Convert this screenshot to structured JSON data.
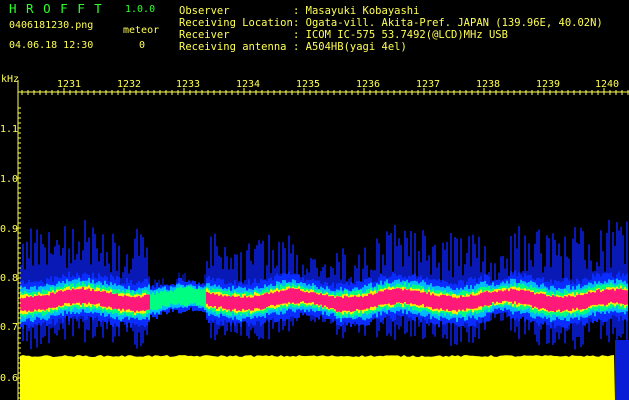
{
  "header": {
    "app_name": "H R O F F T",
    "version": "1.0.0",
    "filename": "0406181230.png",
    "datetime": "04.06.18 12:30",
    "meteor_label": "meteor",
    "meteor_count": "0"
  },
  "info": [
    {
      "label": "Observer",
      "value": ": Masayuki Kobayashi"
    },
    {
      "label": "Receiving Location",
      "value": ": Ogata-vill. Akita-Pref. JAPAN (139.96E, 40.02N)"
    },
    {
      "label": "Receiver",
      "value": ": ICOM IC-575 53.7492(@LCD)MHz USB"
    },
    {
      "label": "Receiving antenna",
      "value": ": A504HB(yagi 4el)"
    }
  ],
  "axis": {
    "y_unit": "kHz",
    "y_ticks": [
      "1.1",
      "1.0",
      "0.9",
      "0.8",
      "0.7",
      "0.6"
    ],
    "x_ticks": [
      "1231",
      "1232",
      "1233",
      "1234",
      "1235",
      "1236",
      "1237",
      "1238",
      "1239",
      "1240"
    ]
  },
  "colors": {
    "text": "#ffff55",
    "title": "#2cff2c",
    "noise_floor": "#ffff00",
    "signal_core": "#ff1a7a"
  }
}
